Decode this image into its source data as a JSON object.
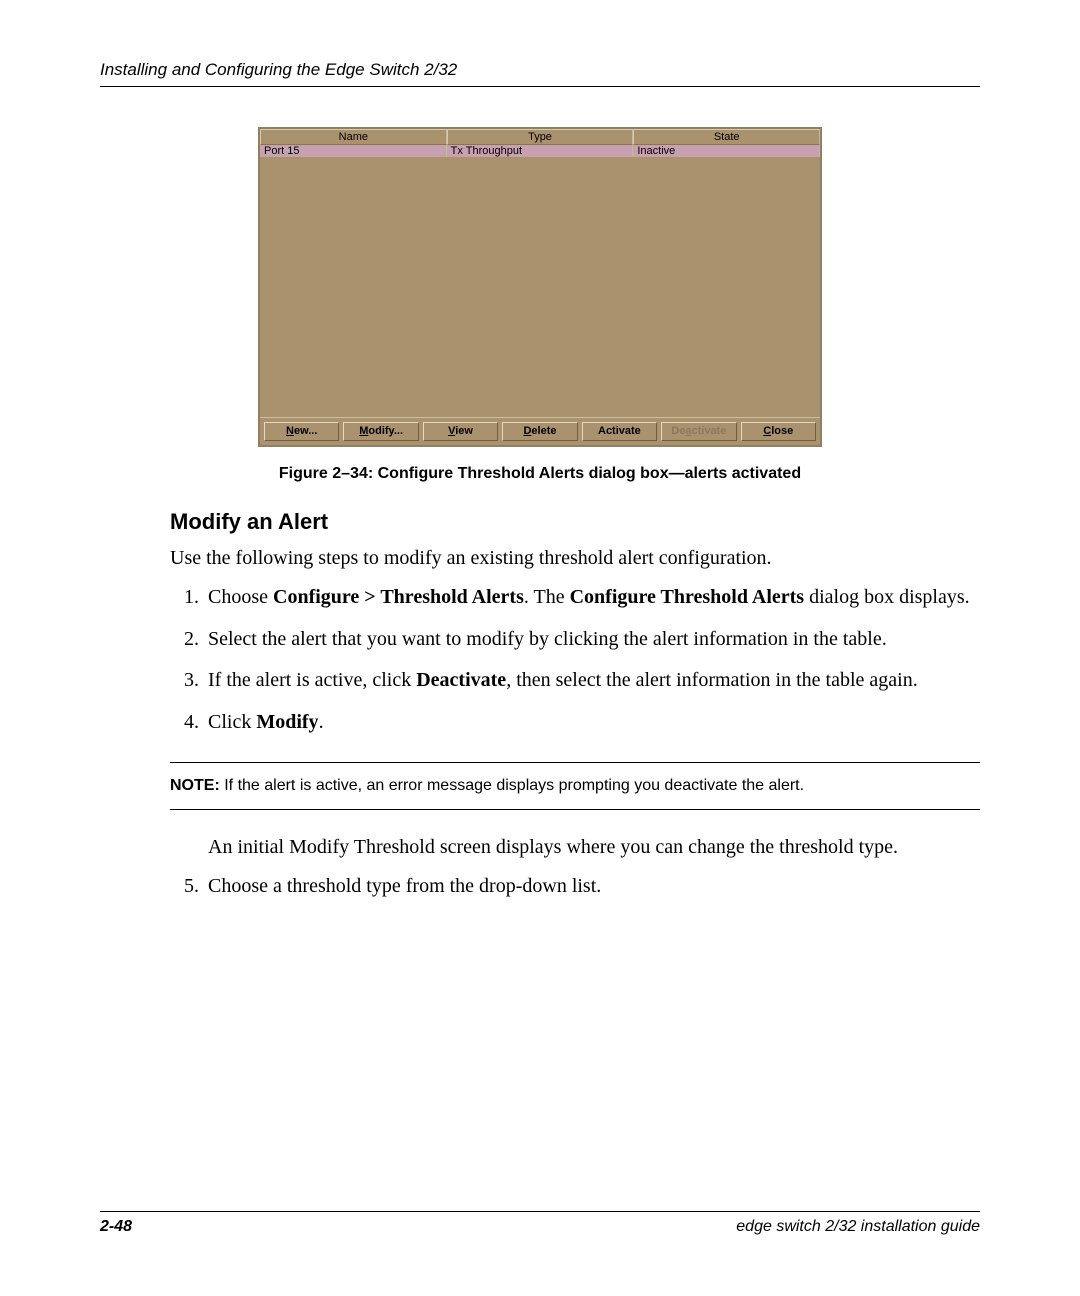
{
  "header": {
    "running_title": "Installing and Configuring the Edge Switch 2/32"
  },
  "dialog": {
    "columns": {
      "c0": "Name",
      "c1": "Type",
      "c2": "State"
    },
    "row": {
      "name": "Port 15",
      "type": "Tx Throughput",
      "state": "Inactive"
    },
    "buttons": {
      "new": "New...",
      "modify": "Modify...",
      "view": "View",
      "delete": "Delete",
      "activate": "Activate",
      "deactivate": "Deactivate",
      "close": "Close"
    }
  },
  "figure_caption": "Figure 2–34:  Configure Threshold Alerts dialog box—alerts activated",
  "section_heading": "Modify an Alert",
  "intro_para": "Use the following steps to modify an existing threshold alert configuration.",
  "steps": {
    "s1_a": "Choose ",
    "s1_b": "Configure > Threshold Alerts",
    "s1_c": ". The ",
    "s1_d": "Configure Threshold Alerts",
    "s1_e": " dialog box displays.",
    "s2": "Select the alert that you want to modify by clicking the alert information in the table.",
    "s3_a": "If the alert is active, click ",
    "s3_b": "Deactivate",
    "s3_c": ", then select the alert information in the table again.",
    "s4_a": "Click ",
    "s4_b": "Modify",
    "s4_c": ".",
    "note_a": "NOTE:",
    "note_b": "  If the alert is active, an error message displays prompting you deactivate the alert.",
    "post_note": "An initial Modify Threshold screen displays where you can change the threshold type.",
    "s5": "Choose a threshold type from the drop-down list."
  },
  "footer": {
    "page": "2-48",
    "doc": "edge switch 2/32 installation guide"
  }
}
